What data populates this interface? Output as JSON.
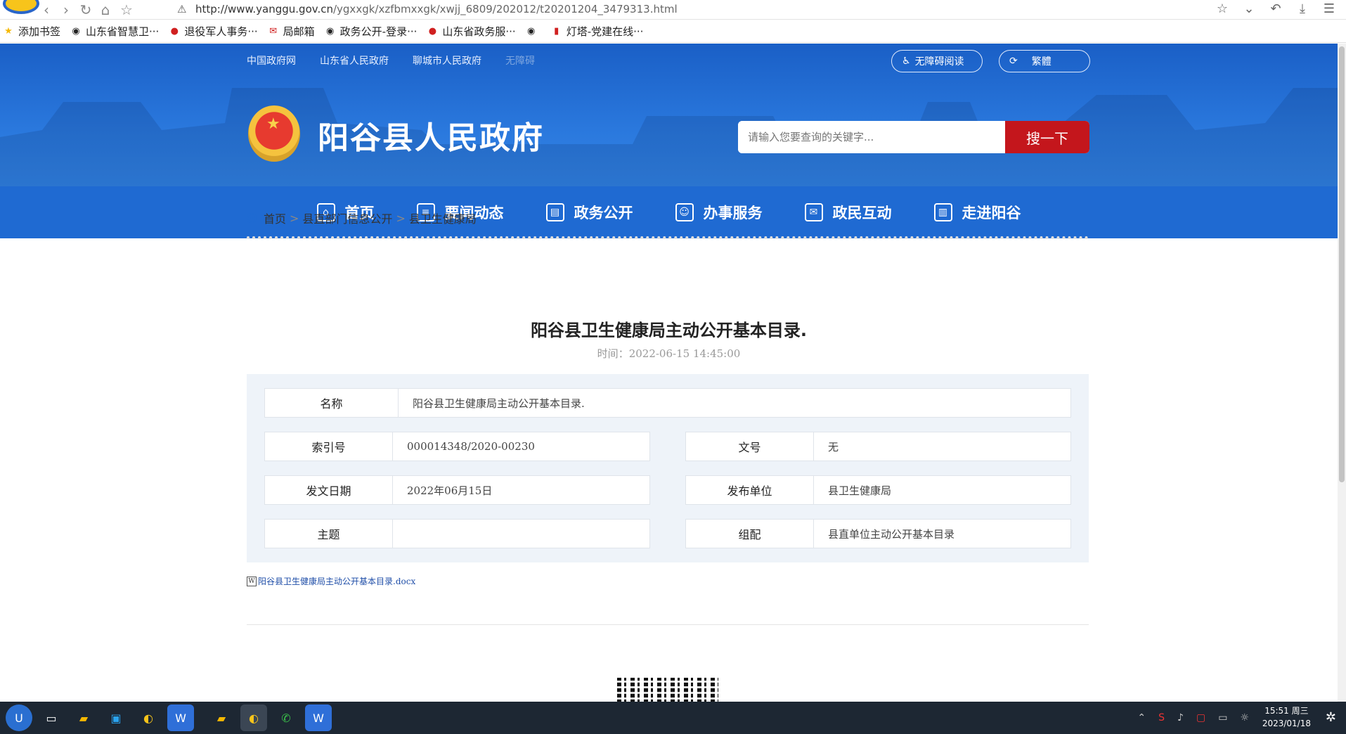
{
  "browser": {
    "url_host": "http://www.yanggu.gov.cn",
    "url_path": "/ygxxgk/xzfbmxxgk/xwjj_6809/202012/t20201204_3479313.html"
  },
  "bookmarks": [
    {
      "label": "添加书签",
      "icon": "star-icon",
      "color": "#f5b800"
    },
    {
      "label": "山东省智慧卫···",
      "icon": "globe-icon",
      "color": "#444"
    },
    {
      "label": "退役军人事务···",
      "icon": "emblem-icon",
      "color": "#d02020"
    },
    {
      "label": "局邮箱",
      "icon": "mail-icon",
      "color": "#d02020"
    },
    {
      "label": "政务公开-登录···",
      "icon": "globe-icon",
      "color": "#444"
    },
    {
      "label": "山东省政务服···",
      "icon": "emblem-icon",
      "color": "#d02020"
    },
    {
      "label": "",
      "icon": "globe-icon",
      "color": "#444"
    },
    {
      "label": "灯塔-党建在线···",
      "icon": "flag-icon",
      "color": "#d02020"
    }
  ],
  "header": {
    "toplinks": [
      "中国政府网",
      "山东省人民政府",
      "聊城市人民政府",
      "无障碍"
    ],
    "accessibility_label": "无障碍阅读",
    "traditional_label": "繁體",
    "site_title": "阳谷县人民政府",
    "search_placeholder": "请输入您要查询的关键字...",
    "search_button": "搜一下"
  },
  "nav": [
    {
      "label": "首页",
      "icon": "home-icon",
      "glyph": "⌂"
    },
    {
      "label": "要闻动态",
      "icon": "news-icon",
      "glyph": "≡"
    },
    {
      "label": "政务公开",
      "icon": "document-icon",
      "glyph": "▤"
    },
    {
      "label": "办事服务",
      "icon": "service-icon",
      "glyph": "☺"
    },
    {
      "label": "政民互动",
      "icon": "chat-icon",
      "glyph": "✉"
    },
    {
      "label": "走进阳谷",
      "icon": "building-icon",
      "glyph": "▥"
    }
  ],
  "breadcrumb": {
    "home": "首页",
    "level1": "县直部门信息公开",
    "level2": "县卫生健康局",
    "separator": ">"
  },
  "article": {
    "title": "阳谷县卫生健康局主动公开基本目录.",
    "time_label": "时间：",
    "time_value": "2022-06-15 14:45:00"
  },
  "meta": {
    "name_label": "名称",
    "name_value": "阳谷县卫生健康局主动公开基本目录.",
    "index_label": "索引号",
    "index_value": "000014348/2020-00230",
    "docno_label": "文号",
    "docno_value": "无",
    "date_label": "发文日期",
    "date_value": "2022年06月15日",
    "issuer_label": "发布单位",
    "issuer_value": "县卫生健康局",
    "topic_label": "主题",
    "topic_value": "",
    "group_label": "组配",
    "group_value": "县直单位主动公开基本目录"
  },
  "attachment": "阳谷县卫生健康局主动公开基本目录.docx",
  "taskbar": {
    "time": "15:51 周三",
    "date": "2023/01/18"
  },
  "colors": {
    "header_blue": "#1f6ad2",
    "search_red": "#c4161c"
  }
}
